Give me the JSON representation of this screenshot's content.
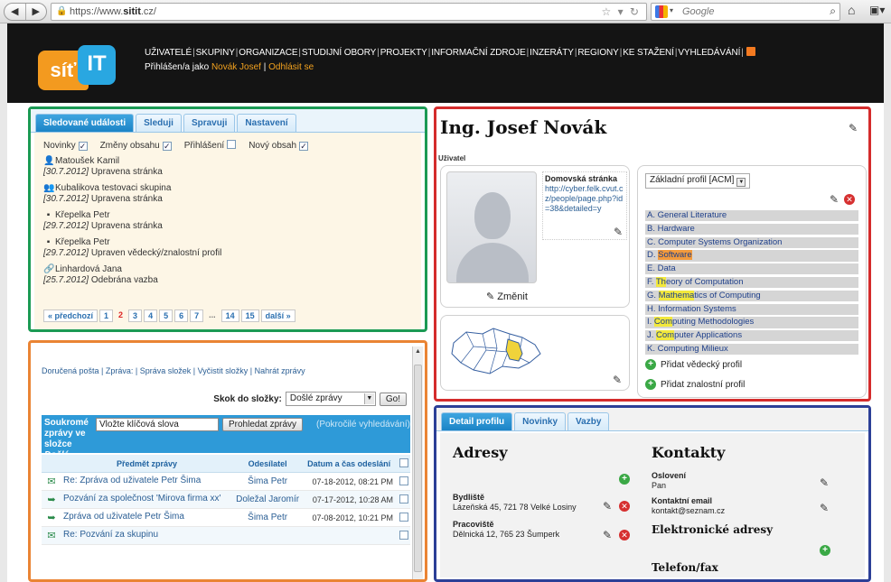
{
  "browser": {
    "url_prefix": "https://www.",
    "url_domain": "sitit",
    "url_suffix": ".cz/",
    "search_placeholder": "Google"
  },
  "header": {
    "logo_left": "síť",
    "logo_right": "IT",
    "nav": [
      "UŽIVATELÉ",
      "SKUPINY",
      "ORGANIZACE",
      "STUDIJNÍ OBORY",
      "PROJEKTY",
      "INFORMAČNÍ ZDROJE",
      "INZERÁTY",
      "REGIONY",
      "KE STAŽENÍ",
      "VYHLEDÁVÁNÍ"
    ],
    "logged_in_prefix": "Přihlášen/a jako ",
    "logged_in_user": "Novák Josef",
    "logout_sep": " | ",
    "logout": "Odhlásit se"
  },
  "events_panel": {
    "tabs": [
      "Sledované události",
      "Sleduji",
      "Spravuji",
      "Nastavení"
    ],
    "filters": [
      {
        "label": "Novinky",
        "checked": true
      },
      {
        "label": "Změny obsahu",
        "checked": true
      },
      {
        "label": "Přihlášení",
        "checked": false
      },
      {
        "label": "Nový obsah",
        "checked": true
      }
    ],
    "events": [
      {
        "icon": "person-icon",
        "who": "Matoušek Kamil",
        "date": "[30.7.2012]",
        "action": "Upravena stránka"
      },
      {
        "icon": "group-icon",
        "who": "Kubalikova testovaci skupina",
        "date": "[30.7.2012]",
        "action": "Upravena stránka"
      },
      {
        "icon": "id-card-icon",
        "who": "Křepelka Petr",
        "date": "[29.7.2012]",
        "action": "Upravena stránka"
      },
      {
        "icon": "id-card-icon",
        "who": "Křepelka Petr",
        "date": "[29.7.2012]",
        "action": "Upraven vědecký/znalostní profil"
      },
      {
        "icon": "link-person-icon",
        "who": "Linhardová Jana",
        "date": "[25.7.2012]",
        "action": "Odebrána vazba"
      }
    ],
    "pager": {
      "prev": "« předchozí",
      "pages": [
        "1",
        "2",
        "3",
        "4",
        "5",
        "6",
        "7"
      ],
      "current": "2",
      "ellipsis": "...",
      "tail": [
        "14",
        "15"
      ],
      "next": "další »"
    }
  },
  "mail_panel": {
    "links": "Doručená pošta | Zpráva: | Správa složek | Vyčistit složky | Nahrát zprávy",
    "goto_label": "Skok do složky:",
    "goto_value": "Došlé zprávy",
    "goto_button": "Go!",
    "title_line1": "Soukromé",
    "title_line2": "zprávy ve",
    "title_line3": "složce",
    "title_folder": "Došlé zprávy",
    "keyword_value": "Vložte klíčová slova",
    "search_button": "Prohledat zprávy",
    "advanced": "(Pokročilé vyhledávání)",
    "columns": [
      "Předmět zprávy",
      "Odesílatel",
      "Datum a čas odeslání"
    ],
    "rows": [
      {
        "icon": "envelope-open-icon",
        "subject": "Re: Zpráva od uživatele Petr Šima",
        "sender": "Šima Petr",
        "date": "07-18-2012, 08:21 PM"
      },
      {
        "icon": "forward-icon",
        "subject": "Pozvání za společnost 'Mirova firma xx'",
        "sender": "Doležal Jaromír",
        "date": "07-17-2012, 10:28 AM"
      },
      {
        "icon": "forward-icon",
        "subject": "Zpráva od uživatele Petr Šima",
        "sender": "Šima Petr",
        "date": "07-08-2012, 10:21 PM"
      },
      {
        "icon": "envelope-icon",
        "subject": "Re: Pozvání za skupinu",
        "sender": "",
        "date": ""
      }
    ]
  },
  "profile_panel": {
    "name": "Ing. Josef Novák",
    "role": "Uživatel",
    "homepage_label": "Domovská stránka",
    "homepage_url": "http://cyber.felk.cvut.cz/people/page.php?id=38&detailed=y",
    "change_photo": "Změnit",
    "profile_select": "Základní profil [ACM]",
    "acm_items": [
      {
        "pre": "A. ",
        "hl": "",
        "post": "General Literature",
        "hl_type": ""
      },
      {
        "pre": "B. ",
        "hl": "",
        "post": "Hardware",
        "hl_type": ""
      },
      {
        "pre": "C. ",
        "hl": "",
        "post": "Computer Systems Organization",
        "hl_type": ""
      },
      {
        "pre": "D. ",
        "hl": "Software",
        "post": "",
        "hl_type": "orange"
      },
      {
        "pre": "E. ",
        "hl": "",
        "post": "Data",
        "hl_type": ""
      },
      {
        "pre": "F. ",
        "hl": "Th",
        "post": "eory of Computation",
        "hl_type": "yellow"
      },
      {
        "pre": "G. ",
        "hl": "Mathema",
        "post": "tics of Computing",
        "hl_type": "yellow"
      },
      {
        "pre": "H. ",
        "hl": "",
        "post": "Information Systems",
        "hl_type": ""
      },
      {
        "pre": "I. ",
        "hl": "Com",
        "post": "puting Methodologies",
        "hl_type": "yellow"
      },
      {
        "pre": "J. ",
        "hl": "Com",
        "post": "puter Applications",
        "hl_type": "yellow"
      },
      {
        "pre": "K. ",
        "hl": "",
        "post": "Computing Milieux",
        "hl_type": ""
      }
    ],
    "add_scientific": "Přidat vědecký profil",
    "add_knowledge": "Přidat znalostní profil"
  },
  "detail_panel": {
    "tabs": [
      "Detail profilu",
      "Novinky",
      "Vazby"
    ],
    "addresses_title": "Adresy",
    "residence_label": "Bydliště",
    "residence_value": "Lázeňská 45, 721 78 Velké Losiny",
    "workplace_label": "Pracoviště",
    "workplace_value": "Dělnická 12, 765 23 Šumperk",
    "contacts_title": "Kontakty",
    "salutation_label": "Oslovení",
    "salutation_value": "Pan",
    "email_label": "Kontaktní email",
    "email_value": "kontakt@seznam.cz",
    "eaddr_title": "Elektronické adresy",
    "phone_title": "Telefon/fax"
  },
  "colors": {
    "frame_green": "#1b9a54",
    "frame_orange": "#ea8434",
    "frame_red": "#d42c2c",
    "frame_blue": "#2c3f97",
    "tab_active": "#1c84c6",
    "logo_orange": "#f39a1f",
    "logo_blue": "#29a7e1"
  }
}
